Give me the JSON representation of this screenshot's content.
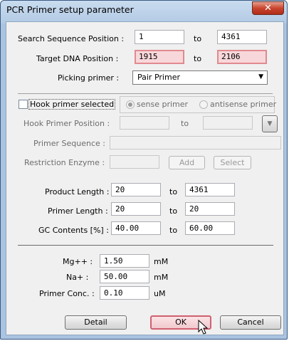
{
  "window": {
    "title": "PCR Primer setup parameter",
    "close_glyph": "✕"
  },
  "search_position": {
    "label": "Search Sequence Position :",
    "from": "1",
    "to_label": "to",
    "to": "4361"
  },
  "target_position": {
    "label": "Target DNA Position :",
    "from": "1915",
    "to_label": "to",
    "to": "2106"
  },
  "picking": {
    "label": "Picking primer :",
    "selected": "Pair Primer",
    "dropdown_glyph": "▼"
  },
  "hook": {
    "checkbox_label": "Hook primer selected",
    "sense_label": "sense primer",
    "antisense_label": "antisense primer",
    "position_label": "Hook Primer Position :",
    "position_to_label": "to",
    "position_from": "",
    "position_to": "",
    "down_glyph": "▼",
    "sequence_label": "Primer Sequence :",
    "sequence": "",
    "enzyme_label": "Restriction Enzyme :",
    "enzyme": "",
    "add_label": "Add",
    "select_label": "Select"
  },
  "product_length": {
    "label": "Product Length :",
    "from": "20",
    "to_label": "to",
    "to": "4361"
  },
  "primer_length": {
    "label": "Primer Length :",
    "from": "20",
    "to_label": "to",
    "to": "20"
  },
  "gc_contents": {
    "label": "GC Contents [%] :",
    "from": "40.00",
    "to_label": "to",
    "to": "60.00"
  },
  "mg": {
    "label": "Mg++ :",
    "value": "1.50",
    "unit": "mM"
  },
  "na": {
    "label": "Na+ :",
    "value": "50.00",
    "unit": "mM"
  },
  "primer_conc": {
    "label": "Primer Conc. :",
    "value": "0.10",
    "unit": "uM"
  },
  "buttons": {
    "detail": "Detail",
    "ok": "OK",
    "cancel": "Cancel"
  }
}
